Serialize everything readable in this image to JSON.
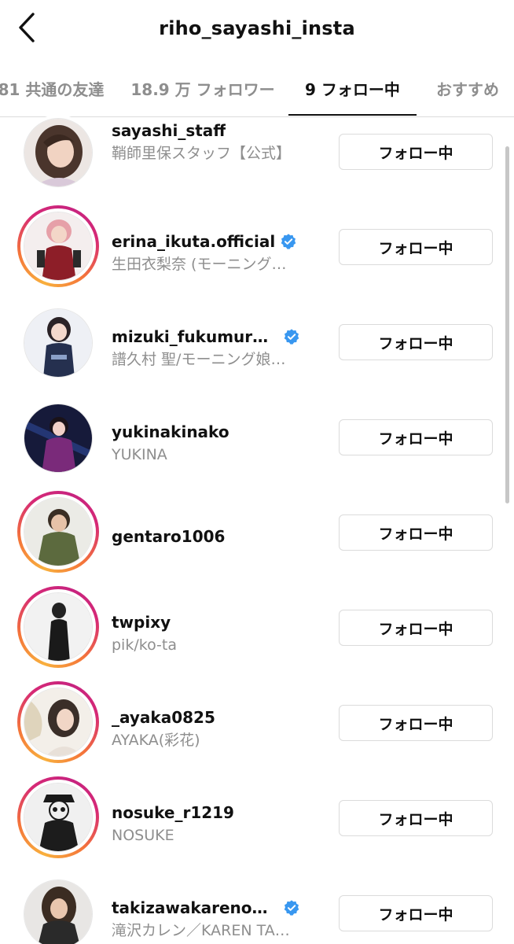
{
  "header": {
    "title": "riho_sayashi_insta"
  },
  "tabs": [
    {
      "label": "81 共通の友達"
    },
    {
      "label": "18.9 万 フォロワー"
    },
    {
      "label": "9 フォロー中"
    },
    {
      "label": "おすすめ"
    }
  ],
  "accounts": [
    {
      "username": "sayashi_staff",
      "fullname": "鞘師里保スタッフ【公式】",
      "verified": false,
      "button": "フォロー中"
    },
    {
      "username": "erina_ikuta.official",
      "fullname": "生田衣梨奈 (モーニング…",
      "verified": true,
      "button": "フォロー中"
    },
    {
      "username": "mizuki_fukumura....",
      "fullname": "譜久村 聖/モーニング娘…",
      "verified": true,
      "button": "フォロー中"
    },
    {
      "username": "yukinakinako",
      "fullname": "YUKINA",
      "verified": false,
      "button": "フォロー中"
    },
    {
      "username": "gentaro1006",
      "fullname": "",
      "verified": false,
      "button": "フォロー中"
    },
    {
      "username": "twpixy",
      "fullname": "pik/ko-ta",
      "verified": false,
      "button": "フォロー中"
    },
    {
      "username": "_ayaka0825",
      "fullname": "AYAKA(彩花)",
      "verified": false,
      "button": "フォロー中"
    },
    {
      "username": "nosuke_r1219",
      "fullname": "NOSUKE",
      "verified": false,
      "button": "フォロー中"
    },
    {
      "username": "takizawakarenoffi...",
      "fullname": "滝沢カレン／KAREN TA…",
      "verified": true,
      "button": "フォロー中"
    }
  ],
  "colors": {
    "verified": "#3897f0",
    "ring_start": "#f8b03d",
    "ring_end": "#c7237f",
    "secondary_text": "#8e8e8e"
  }
}
